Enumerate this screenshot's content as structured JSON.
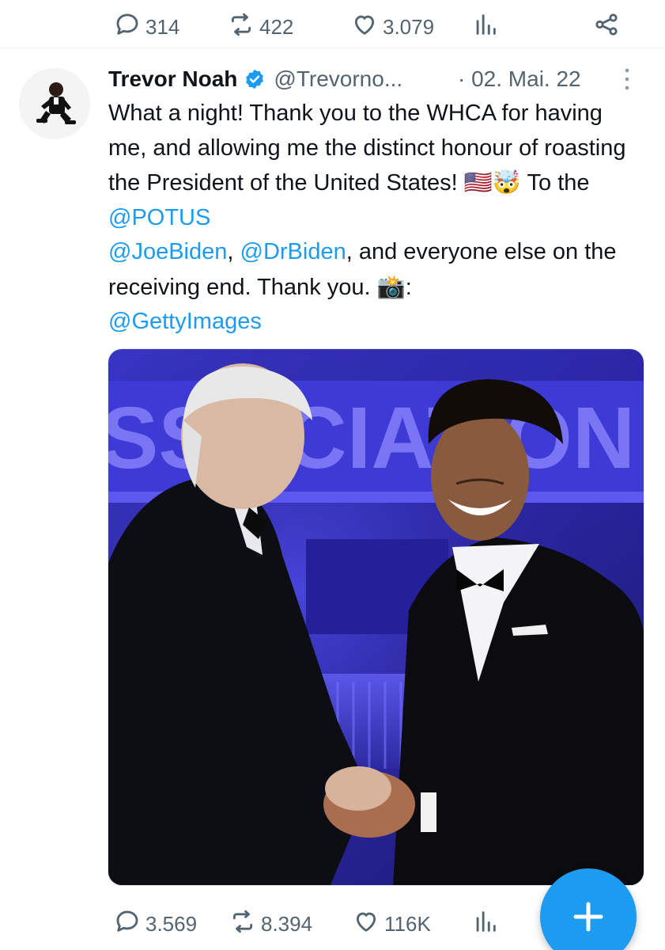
{
  "top_actions": {
    "replies": "314",
    "retweets": "422",
    "likes": "3.079"
  },
  "tweet": {
    "author_name": "Trevor Noah",
    "handle": "@Trevorno...",
    "date": "· 02. Mai. 22",
    "text": {
      "part1": "What a night! Thank you to the WHCA for having me, and allowing me the distinct honour of roasting the President of the United States! ",
      "emoji1": "🇺🇸🤯",
      "part2": " To the ",
      "mention_potus": "@POTUS",
      "mention_joebiden": "@JoeBiden",
      "comma1": ", ",
      "mention_drbiden": "@DrBiden",
      "part3": ", and everyone else on the receiving end. Thank you. ",
      "emoji2": "📸",
      "colon": ":",
      "mention_getty": "@GettyImages"
    },
    "image_sign_text": "SSOCIATION",
    "actions": {
      "replies": "3.569",
      "retweets": "8.394",
      "likes": "116K"
    }
  },
  "colors": {
    "accent": "#1d9bf0",
    "muted": "#536471",
    "text": "#0f1419",
    "stage_blue": "#3b36c9"
  },
  "icons": [
    "reply-icon",
    "retweet-icon",
    "like-icon",
    "views-icon",
    "share-icon",
    "verified-badge-icon",
    "more-icon",
    "compose-plus-icon"
  ]
}
